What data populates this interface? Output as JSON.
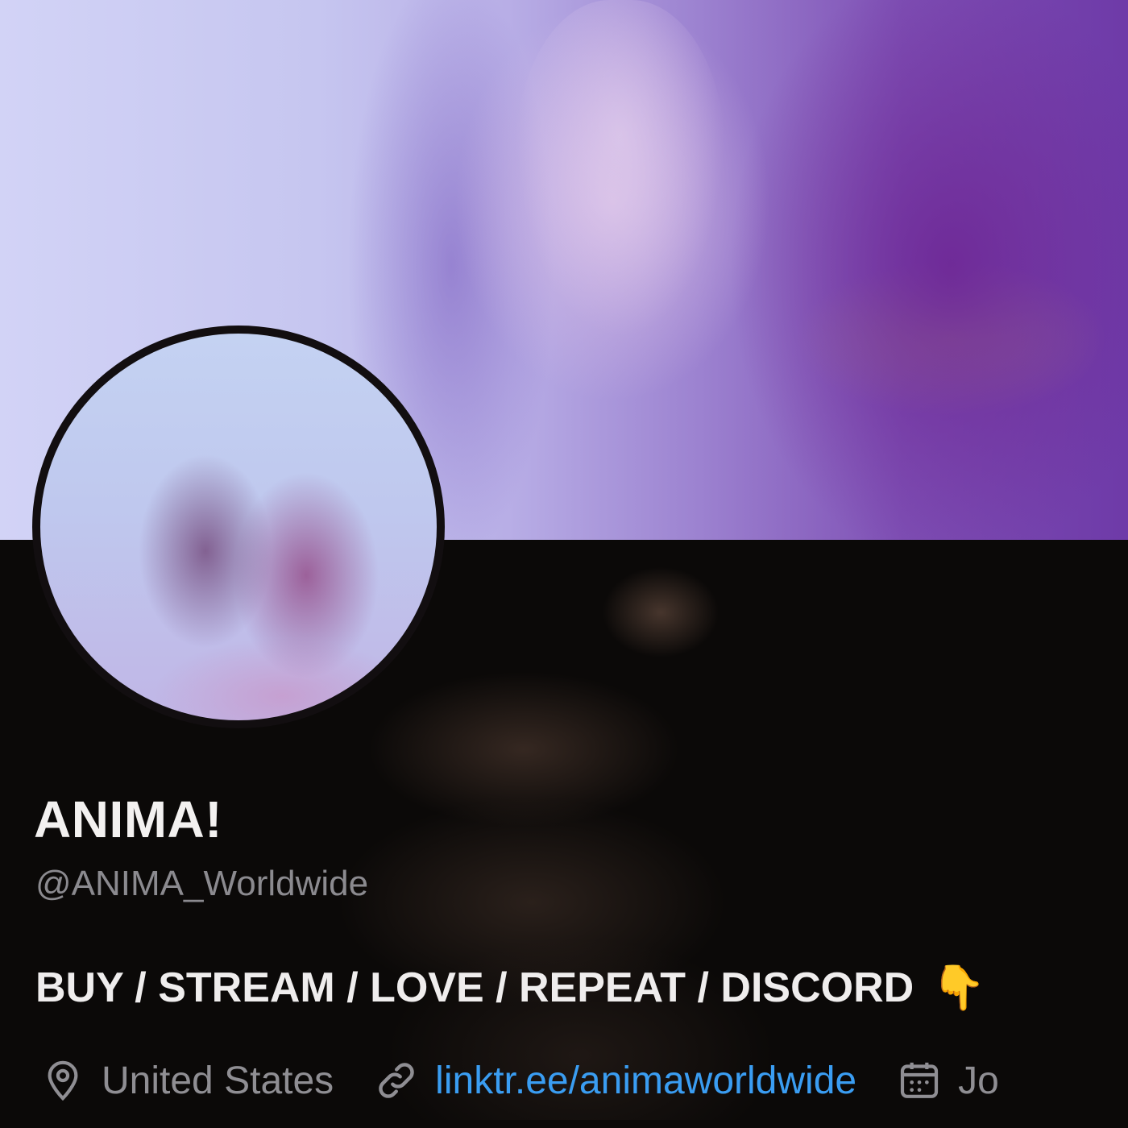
{
  "profile": {
    "display_name": "ANIMA!",
    "handle": "@ANIMA_Worldwide",
    "bio": "BUY / STREAM / LOVE / REPEAT / DISCORD",
    "bio_emoji": "👇",
    "location": "United States",
    "website": "linktr.ee/animaworldwide",
    "joined_partial": "Jo"
  },
  "icons": {
    "location": "location-pin-icon",
    "website": "link-icon",
    "joined": "calendar-icon"
  },
  "colors": {
    "background": "#0b0908",
    "name_text": "#f3f1f0",
    "secondary_text": "#8b8a8f",
    "link": "#3a9df2"
  }
}
